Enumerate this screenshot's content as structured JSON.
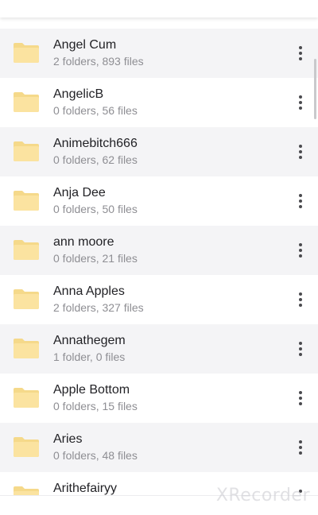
{
  "colors": {
    "row_shaded": "#f4f4f6",
    "row_plain": "#ffffff",
    "folder_fill": "#fbe3a0",
    "folder_back": "#f5d98a",
    "name_text": "#222226",
    "meta_text": "#8e8e93"
  },
  "icons": {
    "folder": "folder-icon",
    "more": "more-vertical-icon"
  },
  "folders": [
    {
      "name": "Angel Cum",
      "meta": "2 folders, 893 files"
    },
    {
      "name": "AngelicB",
      "meta": "0 folders, 56 files"
    },
    {
      "name": "Animebitch666",
      "meta": "0 folders, 62 files"
    },
    {
      "name": "Anja Dee",
      "meta": "0 folders, 50 files"
    },
    {
      "name": "ann moore",
      "meta": "0 folders, 21 files"
    },
    {
      "name": "Anna Apples",
      "meta": "2 folders, 327 files"
    },
    {
      "name": "Annathegem",
      "meta": "1 folder, 0 files"
    },
    {
      "name": "Apple Bottom",
      "meta": "0 folders, 15 files"
    },
    {
      "name": "Aries",
      "meta": "0 folders, 48 files"
    },
    {
      "name": "Arithefairyy",
      "meta": ""
    }
  ],
  "watermark": "XRecorder"
}
